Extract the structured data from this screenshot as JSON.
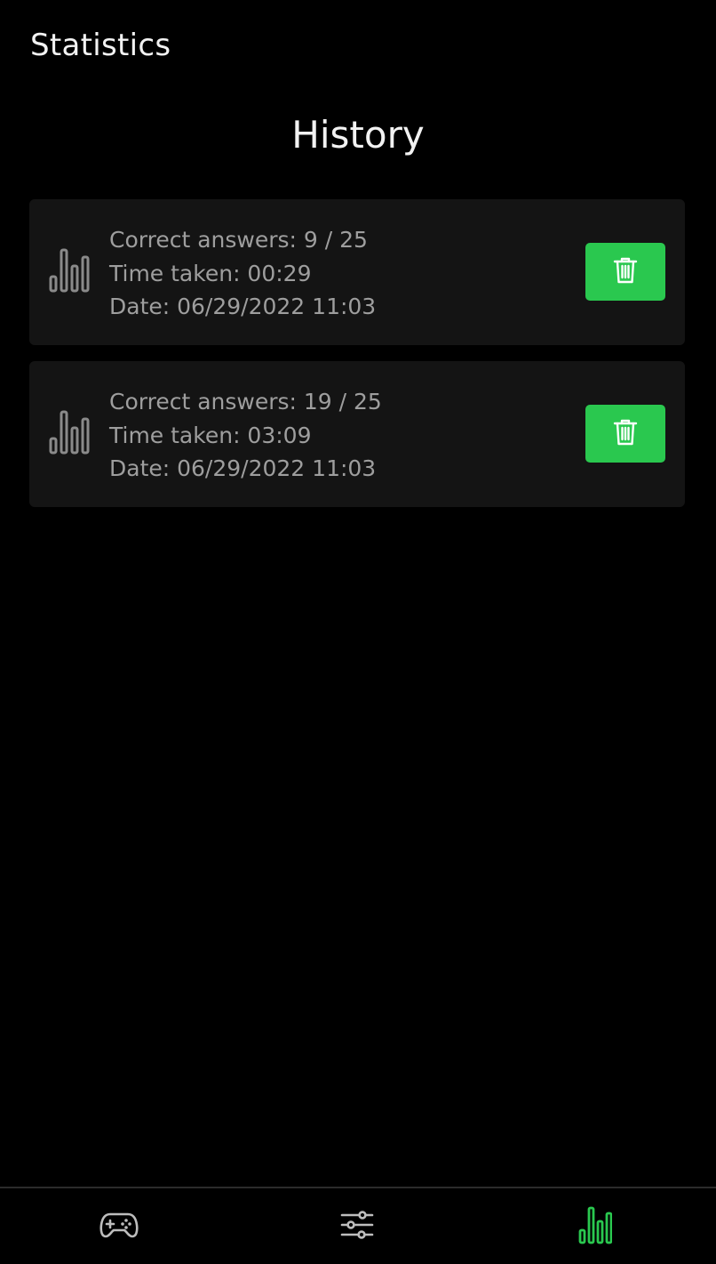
{
  "header": {
    "title": "Statistics"
  },
  "main": {
    "section_title": "History",
    "history": [
      {
        "correct": "Correct answers: 9 / 25",
        "time": "Time taken: 00:29",
        "date": "Date: 06/29/2022 11:03",
        "icon": "bar-chart-icon",
        "delete_icon": "trash-icon"
      },
      {
        "correct": "Correct answers: 19 / 25",
        "time": "Time taken: 03:09",
        "date": "Date: 06/29/2022 11:03",
        "icon": "bar-chart-icon",
        "delete_icon": "trash-icon"
      }
    ]
  },
  "bottom_nav": {
    "items": [
      {
        "icon": "gamepad-icon",
        "active": false
      },
      {
        "icon": "sliders-icon",
        "active": false
      },
      {
        "icon": "bar-chart-icon",
        "active": true
      }
    ]
  },
  "colors": {
    "background": "#000000",
    "card": "#141414",
    "accent": "#2ac84f",
    "muted_text": "#9e9e9e",
    "inactive_icon": "#bdbdbd"
  }
}
